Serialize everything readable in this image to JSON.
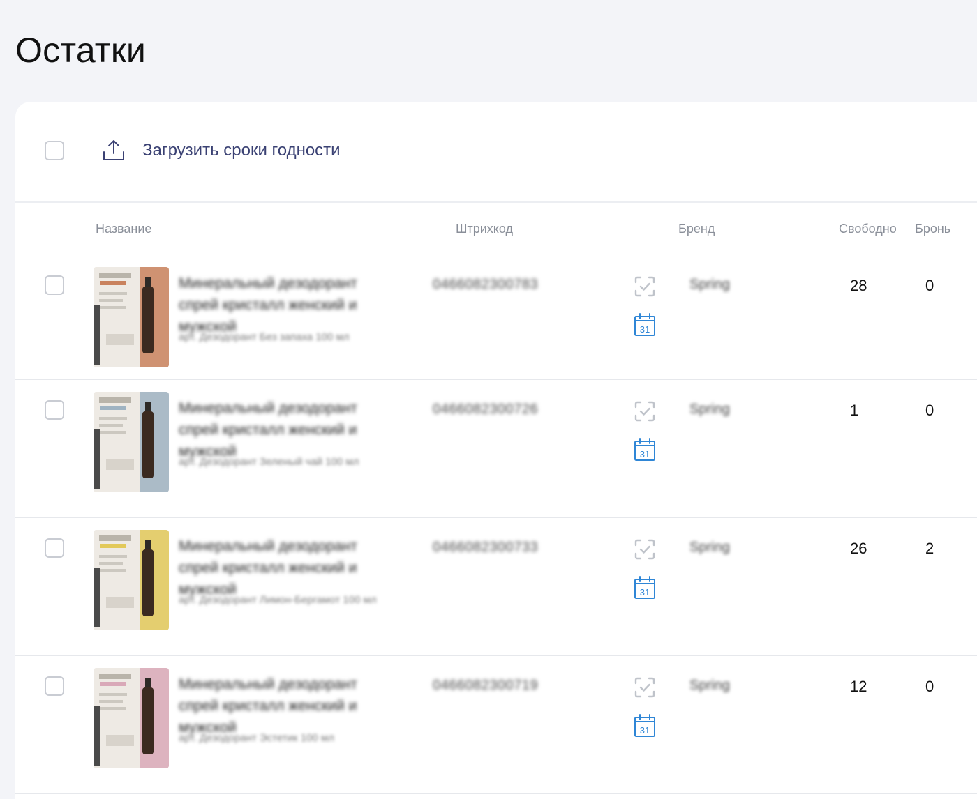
{
  "page": {
    "title": "Остатки"
  },
  "toolbar": {
    "upload_label": "Загрузить сроки годности"
  },
  "columns": {
    "name": "Название",
    "barcode": "Штрихкод",
    "brand": "Бренд",
    "free": "Свободно",
    "reserved": "Бронь"
  },
  "rows": [
    {
      "name": "Минеральный дезодорант спрей кристалл женский и мужской",
      "article": "арт. Дезодорант Без запаха 100 мл",
      "barcode": "0466082300783",
      "brand": "Spring",
      "free": "28",
      "reserved": "0",
      "thumb_accent": "#c9825e"
    },
    {
      "name": "Минеральный дезодорант спрей кристалл женский и мужской",
      "article": "арт. Дезодорант Зеленый чай 100 мл",
      "barcode": "0466082300726",
      "brand": "Spring",
      "free": "1",
      "reserved": "0",
      "thumb_accent": "#9fb3c2"
    },
    {
      "name": "Минеральный дезодорант спрей кристалл женский и мужской",
      "article": "арт. Дезодорант Лимон-Бергамот 100 мл",
      "barcode": "0466082300733",
      "brand": "Spring",
      "free": "26",
      "reserved": "2",
      "thumb_accent": "#e2c95a"
    },
    {
      "name": "Минеральный дезодорант спрей кристалл женский и мужской",
      "article": "арт. Дезодорант Эстетик 100 мл",
      "barcode": "0466082300719",
      "brand": "Spring",
      "free": "12",
      "reserved": "0",
      "thumb_accent": "#d9a9b8"
    }
  ],
  "calendar_icon_day": "31",
  "colors": {
    "background": "#f3f4f8",
    "link": "#3a4173",
    "calendar_blue": "#2f86d6"
  }
}
